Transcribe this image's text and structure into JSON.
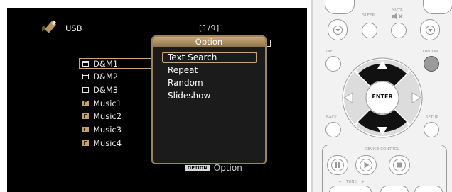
{
  "osd": {
    "source_label": "USB",
    "page_indicator": "[1/9]",
    "list": [
      {
        "label": "D&M1",
        "type": "folder"
      },
      {
        "label": "D&M2",
        "type": "folder"
      },
      {
        "label": "D&M3",
        "type": "folder"
      },
      {
        "label": "Music1",
        "type": "music"
      },
      {
        "label": "Music2",
        "type": "music"
      },
      {
        "label": "Music3",
        "type": "music"
      },
      {
        "label": "Music4",
        "type": "music"
      }
    ],
    "option_menu": {
      "title": "Option",
      "items": [
        "Text Search",
        "Repeat",
        "Random",
        "Slideshow"
      ],
      "selected": "Text Search"
    },
    "hint": {
      "badge": "OPTION",
      "label": "Option"
    },
    "colors": {
      "accent": "#c7a375",
      "background": "#000000",
      "text": "#e6e6e6"
    }
  },
  "remote": {
    "labels": {
      "sleep": "SLEEP",
      "mute": "MUTE",
      "info": "INFO",
      "option": "OPTION",
      "back": "BACK",
      "setup": "SETUP",
      "enter": "ENTER",
      "device_control": "DEVICE CONTROL",
      "tune": "TUNE",
      "minus": "−",
      "plus": "+"
    },
    "icons": [
      "speaker-mute-icon",
      "arrow-up-icon",
      "arrow-down-icon",
      "arrow-left-icon",
      "arrow-right-icon",
      "pause-icon",
      "play-icon",
      "stop-icon",
      "chevron-down-icon"
    ]
  }
}
